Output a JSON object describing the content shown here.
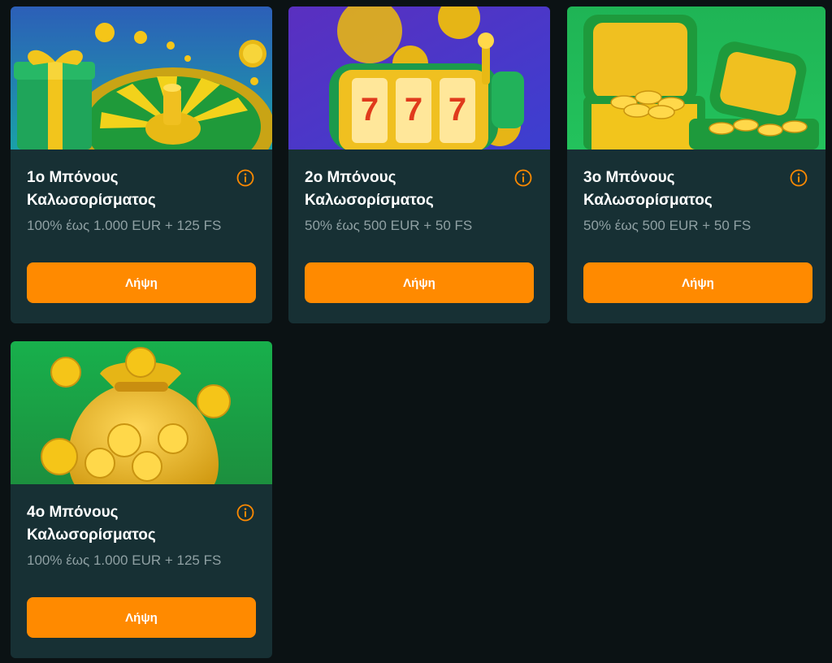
{
  "bonuses": [
    {
      "title": "1ο Μπόνους\nΚαλωσορίσματος",
      "description": "100% έως 1.000 EUR + 125 FS",
      "button_label": "Λήψη",
      "image_icon": "roulette-gift-illustration"
    },
    {
      "title": "2ο Μπόνους\nΚαλωσορίσματος",
      "description": "50% έως 500 EUR + 50 FS",
      "button_label": "Λήψη",
      "image_icon": "slot-machine-illustration"
    },
    {
      "title": "3ο Μπόνους\nΚαλωσορίσματος",
      "description": "50% έως 500 EUR + 50 FS",
      "button_label": "Λήψη",
      "image_icon": "treasure-chest-illustration"
    },
    {
      "title": "4ο Μπόνους\nΚαλωσορίσματος",
      "description": "100% έως 1.000 EUR + 125 FS",
      "button_label": "Λήψη",
      "image_icon": "money-bag-illustration"
    }
  ],
  "colors": {
    "page_background": "#0b1214",
    "card_background": "#173034",
    "button": "#ff8a00",
    "info_icon": "#ff8a00",
    "title_text": "#ffffff",
    "description_text": "#8fa0a3"
  }
}
